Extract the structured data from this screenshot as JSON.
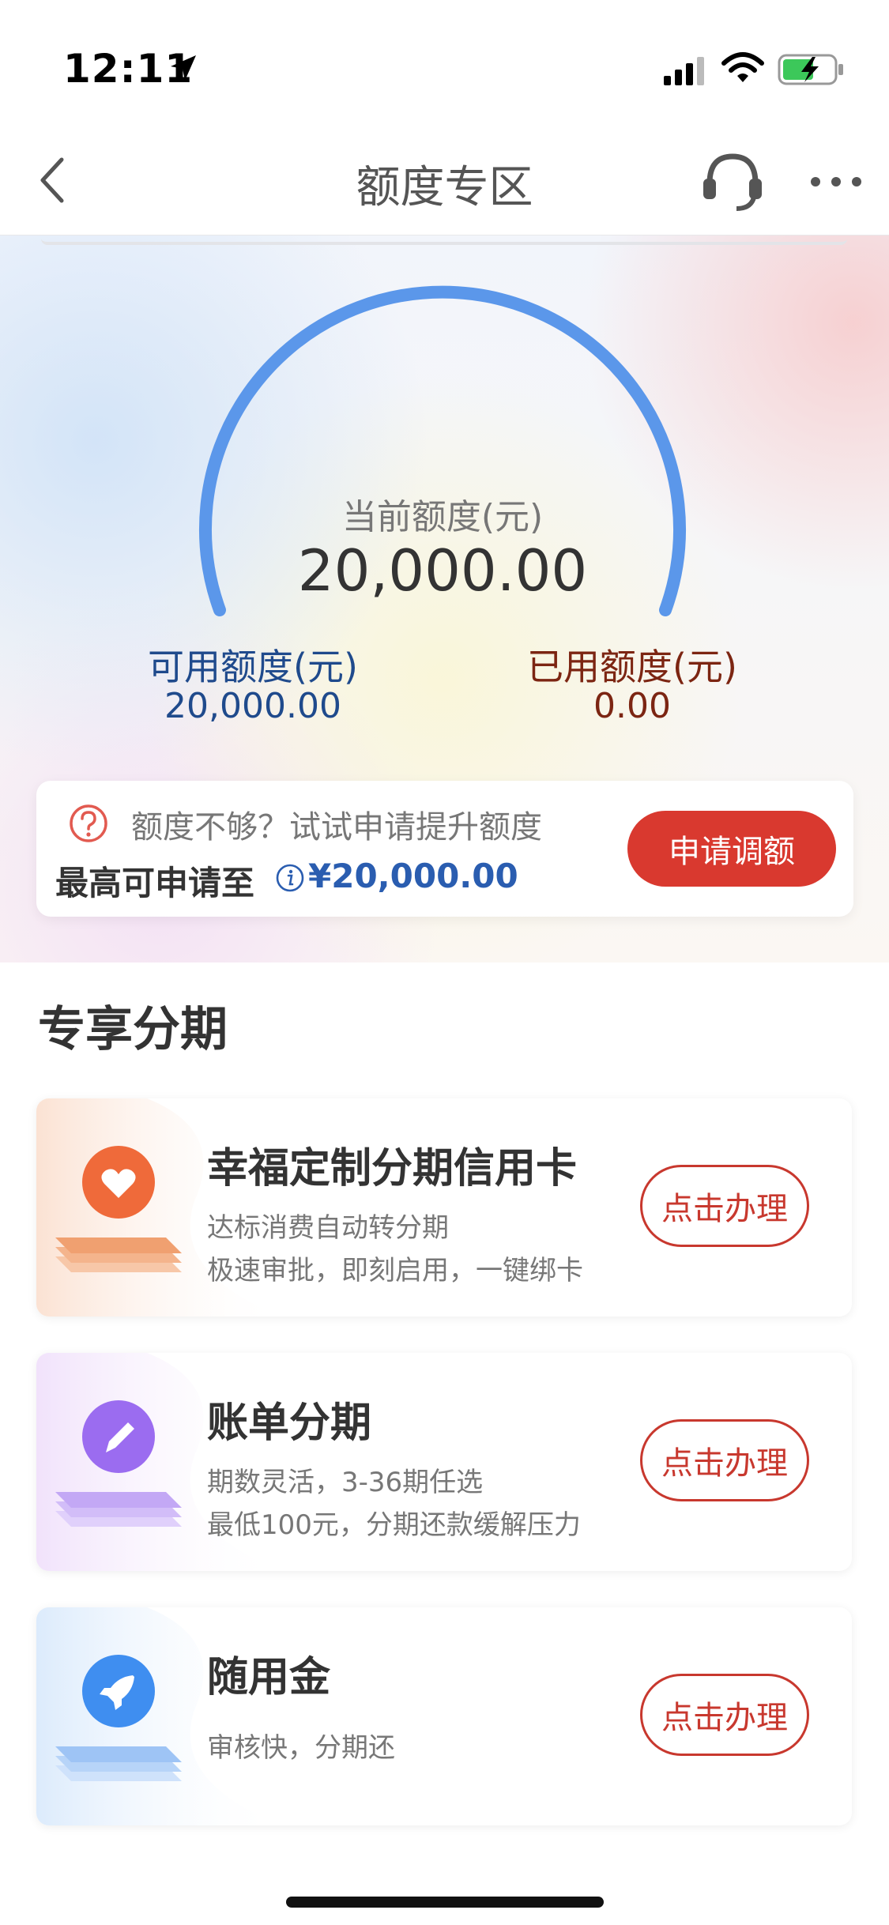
{
  "status_bar": {
    "time": "12:11"
  },
  "nav": {
    "title": "额度专区"
  },
  "gauge": {
    "label": "当前额度(元)",
    "value": "20,000.00"
  },
  "available": {
    "label": "可用额度(元)",
    "value": "20,000.00"
  },
  "used": {
    "label": "已用额度(元)",
    "value": "0.00"
  },
  "limit_card": {
    "hint": "额度不够？试试申请提升额度",
    "max_label": "最高可申请至",
    "max_value": "¥20,000.00",
    "apply_button": "申请调额"
  },
  "section": {
    "title": "专享分期",
    "products": [
      {
        "title": "幸福定制分期信用卡",
        "lines": [
          "达标消费自动转分期",
          "极速审批，即刻启用，一键绑卡"
        ],
        "button": "点击办理",
        "icon": "heart-icon",
        "accent": "#ef6a3a"
      },
      {
        "title": "账单分期",
        "lines": [
          "期数灵活，3-36期任选",
          "最低100元，分期还款缓解压力"
        ],
        "button": "点击办理",
        "icon": "pencil-icon",
        "accent": "#9b6cf0"
      },
      {
        "title": "随用金",
        "lines": [
          "审核快，分期还"
        ],
        "button": "点击办理",
        "icon": "rocket-icon",
        "accent": "#3f8ef0"
      }
    ]
  },
  "colors": {
    "primary_red": "#d9392f",
    "gauge_blue": "#5b97ea",
    "available_blue": "#1f4a8c",
    "used_brown": "#7c2512"
  }
}
